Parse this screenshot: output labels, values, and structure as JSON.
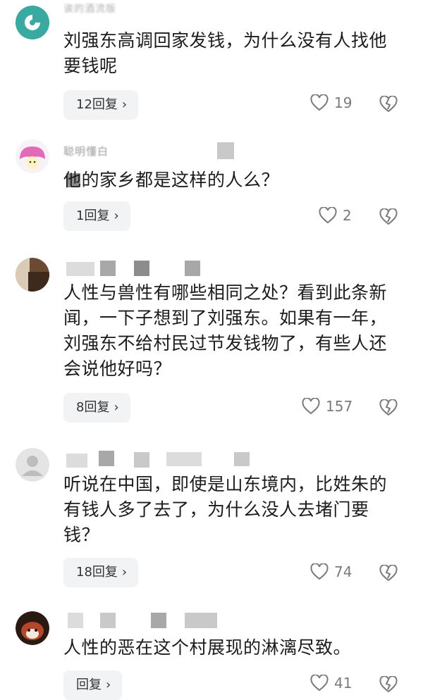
{
  "comments": [
    {
      "username": "诶的酒流版",
      "text": "刘强东高调回家发钱，为什么没有人找他要钱呢",
      "reply_label": "12回复",
      "likes": "19"
    },
    {
      "username": "聪明懂白",
      "text": "他的家乡都是这样的人么？",
      "reply_label": "1回复",
      "likes": "2"
    },
    {
      "username": "",
      "text": "人性与兽性有哪些相同之处？看到此条新闻，一下子想到了刘强东。如果有一年，刘强东不给村民过节发钱物了，有些人还会说他好吗？",
      "reply_label": "8回复",
      "likes": "157"
    },
    {
      "username": "",
      "text": "听说在中国，即使是山东境内，比姓朱的有钱人多了去了，为什么没人去堵门要钱？",
      "reply_label": "18回复",
      "likes": "74"
    },
    {
      "username": "",
      "text": "人性的恶在这个村展现的淋漓尽致。",
      "reply_label": "回复",
      "likes": "41"
    }
  ],
  "icons": {
    "like": "heart-outline-icon",
    "dislike": "broken-heart-icon",
    "reply_arrow": "chevron-right-icon"
  },
  "colors": {
    "reply_bg": "#f2f3f5",
    "meta_text": "#7a7a7a"
  }
}
